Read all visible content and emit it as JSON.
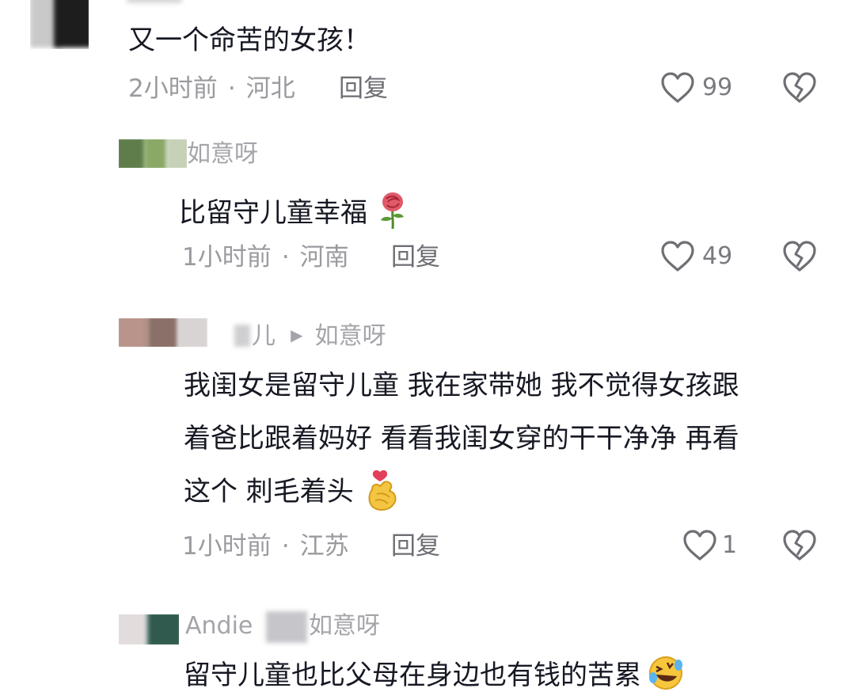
{
  "comments": [
    {
      "text": "又一个命苦的女孩！",
      "time": "2小时前",
      "location": "河北",
      "reply_label": "回复",
      "likes": "99"
    },
    {
      "username": "如意呀",
      "text": "比留守儿童幸福",
      "emoji": "rose",
      "time": "1小时前",
      "location": "河南",
      "reply_label": "回复",
      "likes": "49"
    },
    {
      "username": "儿",
      "reply_arrow": "▶",
      "reply_to": "如意呀",
      "text_lines": [
        "我闺女是留守儿童 我在家带她 我不觉得女孩跟",
        "着爸比跟着妈好 看看我闺女穿的干干净净 再看",
        "这个 刺毛着头"
      ],
      "emoji": "finger-heart",
      "time": "1小时前",
      "location": "江苏",
      "reply_label": "回复",
      "likes": "1"
    },
    {
      "username": "Andie",
      "reply_to": "如意呀",
      "text": "留守儿童也比父母在身边也有钱的苦累",
      "emoji": "laughing-crying"
    }
  ],
  "separator": "·",
  "colors": {
    "text": "#161823",
    "meta": "#9a9a9f",
    "icon": "#6e6e74"
  }
}
